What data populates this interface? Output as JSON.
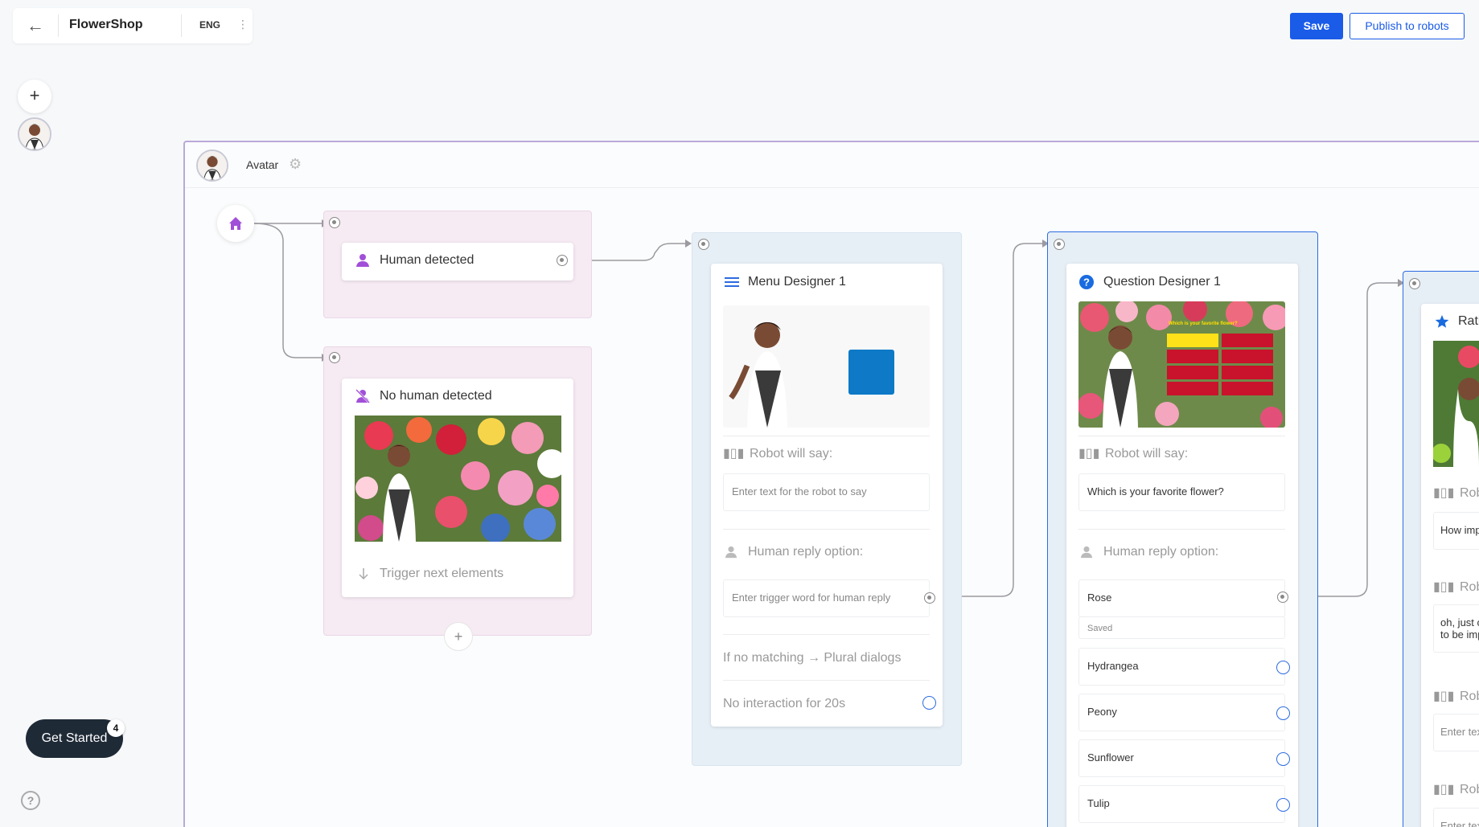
{
  "header": {
    "app_title": "FlowerShop",
    "language": "ENG",
    "save_label": "Save",
    "publish_label": "Publish to robots"
  },
  "rail": {
    "add_symbol": "+"
  },
  "canvas": {
    "avatar_label": "Avatar"
  },
  "triggers": {
    "human_detected": "Human detected",
    "no_human_detected": "No human detected",
    "trigger_next": "Trigger next elements",
    "add_symbol": "+"
  },
  "menu_designer": {
    "title": "Menu Designer 1",
    "robot_will_say": "Robot will say:",
    "robot_placeholder": "Enter text for the robot to say",
    "human_reply": "Human reply option:",
    "human_placeholder": "Enter trigger word for human reply",
    "no_match": "If no matching → Plural dialogs",
    "no_interaction": "No interaction for 20s"
  },
  "question_designer": {
    "title": "Question Designer 1",
    "robot_will_say": "Robot will say:",
    "robot_text": "Which is your favorite flower?",
    "human_reply": "Human reply option:",
    "options": [
      "Rose",
      "Hydrangea",
      "Peony",
      "Sunflower",
      "Tulip"
    ],
    "saved": "Saved",
    "image_question": "Which is your favorite flower?"
  },
  "rating_card": {
    "title_partial": "Rati",
    "rob_label_1": "Rob",
    "text_1": "How imp",
    "rob_label_2": "Rob",
    "text_2a": "oh, just c",
    "text_2b": "to be imp",
    "rob_label_3": "Rob",
    "placeholder_3": "Enter tex",
    "rob_label_4": "Rob",
    "placeholder_4": "Enter tex"
  },
  "get_started": {
    "label": "Get Started",
    "badge": "4"
  },
  "colors": {
    "accent": "#1a5be8",
    "purple": "#a14fd8",
    "canvas_border": "#b9a8d8",
    "dark_pill": "#1f2a37"
  }
}
